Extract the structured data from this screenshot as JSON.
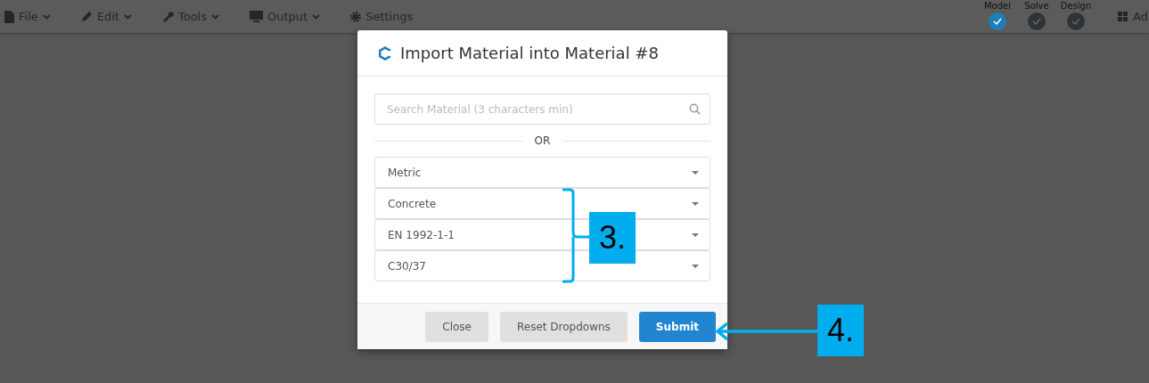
{
  "menu": [
    {
      "label": "File"
    },
    {
      "label": "Edit"
    },
    {
      "label": "Tools"
    },
    {
      "label": "Output"
    },
    {
      "label": "Settings"
    }
  ],
  "steps": [
    {
      "label": "Model",
      "selected": true
    },
    {
      "label": "Solve",
      "selected": false
    },
    {
      "label": "Design",
      "selected": false
    }
  ],
  "account": {
    "label": "Ad"
  },
  "dialog": {
    "title": "Import Material into Material #8",
    "search": {
      "placeholder": "Search Material (3 characters min)"
    },
    "separator": "OR",
    "dropdowns": [
      "Metric",
      "Concrete",
      "EN 1992-1-1",
      "C30/37"
    ],
    "buttons": [
      {
        "label": "Close",
        "kind": "secondary"
      },
      {
        "label": "Reset Dropdowns",
        "kind": "secondary"
      },
      {
        "label": "Submit",
        "kind": "primary"
      }
    ]
  },
  "callouts": [
    {
      "label": "3.",
      "kind": "bracket"
    },
    {
      "label": "4.",
      "kind": "arrow"
    }
  ]
}
